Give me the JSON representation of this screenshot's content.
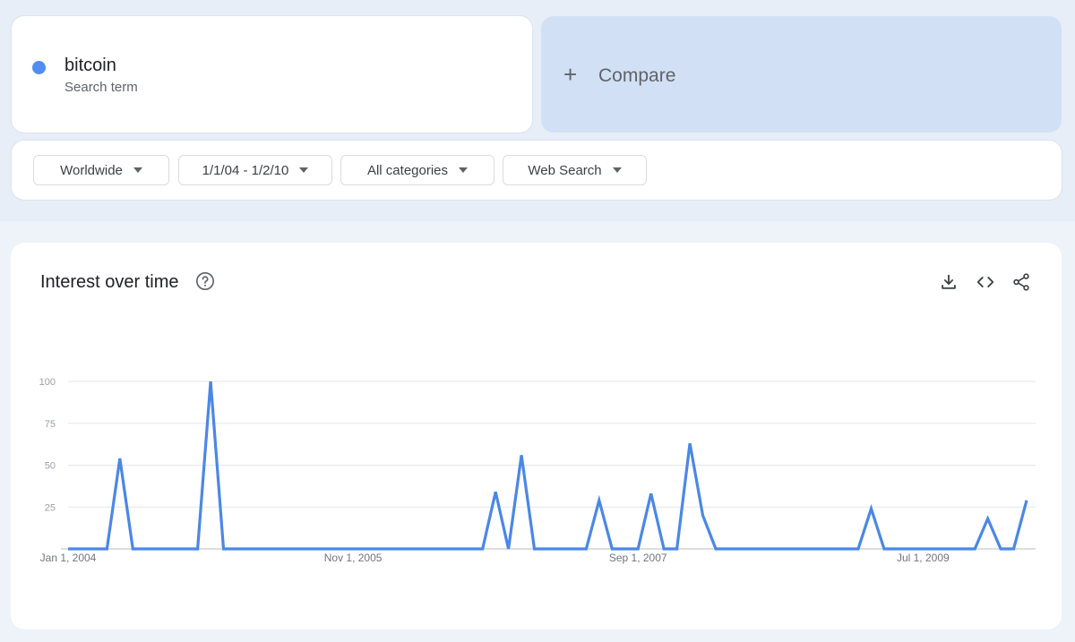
{
  "search_term": {
    "name": "bitcoin",
    "subtitle": "Search term",
    "dot_color": "#4f8ef0"
  },
  "compare": {
    "label": "Compare",
    "icon": "plus-icon"
  },
  "filters": [
    {
      "label": "Worldwide",
      "icon": "caret-down-icon"
    },
    {
      "label": "1/1/04 - 1/2/10",
      "icon": "caret-down-icon"
    },
    {
      "label": "All categories",
      "icon": "caret-down-icon"
    },
    {
      "label": "Web Search",
      "icon": "caret-down-icon"
    }
  ],
  "chart_section": {
    "title": "Interest over time",
    "icons": [
      "help-icon",
      "download-icon",
      "embed-code-icon",
      "share-icon"
    ]
  },
  "chart_data": {
    "type": "line",
    "title": "Interest over time",
    "xlabel": "",
    "ylabel": "",
    "ylim": [
      0,
      100
    ],
    "yticks": [
      100,
      75,
      50,
      25
    ],
    "xtick_labels": [
      "Jan 1, 2004",
      "Nov 1, 2005",
      "Sep 1, 2007",
      "Jul 1, 2009"
    ],
    "grid": true,
    "line_color": "#4a87e8",
    "series": [
      {
        "name": "bitcoin",
        "points": [
          [
            "2004-01",
            0
          ],
          [
            "2004-02",
            0
          ],
          [
            "2004-03",
            0
          ],
          [
            "2004-04",
            0
          ],
          [
            "2004-05",
            54
          ],
          [
            "2004-06",
            0
          ],
          [
            "2004-07",
            0
          ],
          [
            "2004-08",
            0
          ],
          [
            "2004-09",
            0
          ],
          [
            "2004-10",
            0
          ],
          [
            "2004-11",
            0
          ],
          [
            "2004-12",
            100
          ],
          [
            "2005-01",
            0
          ],
          [
            "2005-02",
            0
          ],
          [
            "2005-03",
            0
          ],
          [
            "2005-04",
            0
          ],
          [
            "2005-05",
            0
          ],
          [
            "2005-06",
            0
          ],
          [
            "2005-07",
            0
          ],
          [
            "2005-08",
            0
          ],
          [
            "2005-09",
            0
          ],
          [
            "2005-10",
            0
          ],
          [
            "2005-11",
            0
          ],
          [
            "2005-12",
            0
          ],
          [
            "2006-01",
            0
          ],
          [
            "2006-02",
            0
          ],
          [
            "2006-03",
            0
          ],
          [
            "2006-04",
            0
          ],
          [
            "2006-05",
            0
          ],
          [
            "2006-06",
            0
          ],
          [
            "2006-07",
            0
          ],
          [
            "2006-08",
            0
          ],
          [
            "2006-09",
            0
          ],
          [
            "2006-10",
            34
          ],
          [
            "2006-11",
            0
          ],
          [
            "2006-12",
            56
          ],
          [
            "2007-01",
            0
          ],
          [
            "2007-02",
            0
          ],
          [
            "2007-03",
            0
          ],
          [
            "2007-04",
            0
          ],
          [
            "2007-05",
            0
          ],
          [
            "2007-06",
            29
          ],
          [
            "2007-07",
            0
          ],
          [
            "2007-08",
            0
          ],
          [
            "2007-09",
            0
          ],
          [
            "2007-10",
            33
          ],
          [
            "2007-11",
            0
          ],
          [
            "2007-12",
            0
          ],
          [
            "2008-01",
            63
          ],
          [
            "2008-02",
            20
          ],
          [
            "2008-03",
            0
          ],
          [
            "2008-04",
            0
          ],
          [
            "2008-05",
            0
          ],
          [
            "2008-06",
            0
          ],
          [
            "2008-07",
            0
          ],
          [
            "2008-08",
            0
          ],
          [
            "2008-09",
            0
          ],
          [
            "2008-10",
            0
          ],
          [
            "2008-11",
            0
          ],
          [
            "2008-12",
            0
          ],
          [
            "2009-01",
            0
          ],
          [
            "2009-02",
            0
          ],
          [
            "2009-03",
            24
          ],
          [
            "2009-04",
            0
          ],
          [
            "2009-05",
            0
          ],
          [
            "2009-06",
            0
          ],
          [
            "2009-07",
            0
          ],
          [
            "2009-08",
            0
          ],
          [
            "2009-09",
            0
          ],
          [
            "2009-10",
            0
          ],
          [
            "2009-11",
            0
          ],
          [
            "2009-12",
            18
          ],
          [
            "2010-01",
            0
          ],
          [
            "2010-02",
            0
          ],
          [
            "2010-03",
            29
          ]
        ]
      }
    ]
  }
}
